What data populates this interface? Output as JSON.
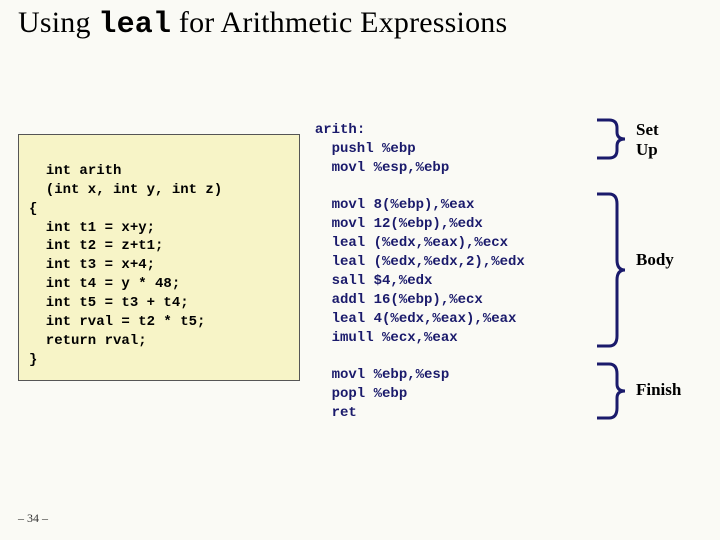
{
  "title": {
    "pre": "Using ",
    "code": "leal",
    "post": " for Arithmetic Expressions"
  },
  "c_code": "int arith\n  (int x, int y, int z)\n{\n  int t1 = x+y;\n  int t2 = z+t1;\n  int t3 = x+4;\n  int t4 = y * 48;\n  int t5 = t3 + t4;\n  int rval = t2 * t5;\n  return rval;\n}",
  "asm_code": "arith:\n    pushl %ebp\n    movl %esp,%ebp\n\n    movl 8(%ebp),%eax\n    movl 12(%ebp),%edx\n    leal (%edx,%eax),%ecx\n    leal (%edx,%edx,2),%edx\n    sall $4,%edx\n    addl 16(%ebp),%ecx\n    leal 4(%edx,%eax),%eax\n    imull %ecx,%eax\n\n    movl %ebp,%esp\n    popl %ebp\n    ret",
  "labels": {
    "setup": "Set\nUp",
    "body": "Body",
    "finish": "Finish"
  },
  "footer": "– 34 –"
}
